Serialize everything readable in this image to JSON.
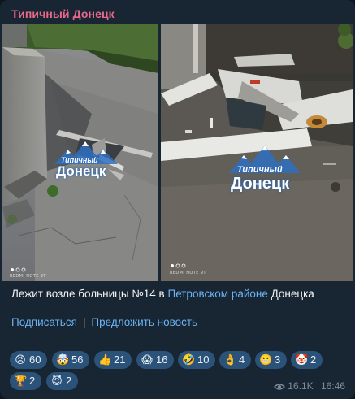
{
  "channel_name": "Типичный Донецк",
  "photos": {
    "left": {
      "watermark": {
        "line1": "Типичный",
        "line2": "Донецк"
      },
      "camera_label": "REDMI NOTE 9T",
      "page_indicator": 3,
      "page_current": 1
    },
    "right": {
      "watermark": {
        "line1": "Типичный",
        "line2": "Донецк"
      },
      "camera_label": "REDMI NOTE 9T",
      "page_indicator": 3,
      "page_current": 1
    }
  },
  "caption": {
    "text_before": "Лежит возле больницы №14 в ",
    "link_text": "Петровском районе",
    "text_after": " Донецка"
  },
  "links": {
    "subscribe": "Подписаться",
    "separator": "|",
    "suggest": "Предложить новость"
  },
  "reactions": [
    {
      "icon": "pouting-face",
      "glyph": "😡",
      "count": "60"
    },
    {
      "icon": "exploding-head",
      "glyph": "🤯",
      "count": "56"
    },
    {
      "icon": "thumbs-up",
      "glyph": "👍",
      "count": "21"
    },
    {
      "icon": "screaming-face",
      "glyph": "😱",
      "count": "16"
    },
    {
      "icon": "rofl-face",
      "glyph": "🤣",
      "count": "10"
    },
    {
      "icon": "ok-hand",
      "glyph": "👌",
      "count": "4"
    },
    {
      "icon": "grimacing-face",
      "glyph": "😬",
      "count": "3"
    },
    {
      "icon": "clown-face",
      "glyph": "🤡",
      "count": "2"
    },
    {
      "icon": "trophy",
      "glyph": "🏆",
      "count": "2"
    },
    {
      "icon": "smiling-imp",
      "glyph": "😈",
      "count": "2"
    }
  ],
  "meta": {
    "views": "16.1K",
    "time": "16:46"
  },
  "colors": {
    "background": "#0e1621",
    "bubble": "#182533",
    "channel_name": "#e8698a",
    "link": "#6ab3f3",
    "reaction_chip": "#2b5278",
    "meta": "#7e8d9d"
  }
}
